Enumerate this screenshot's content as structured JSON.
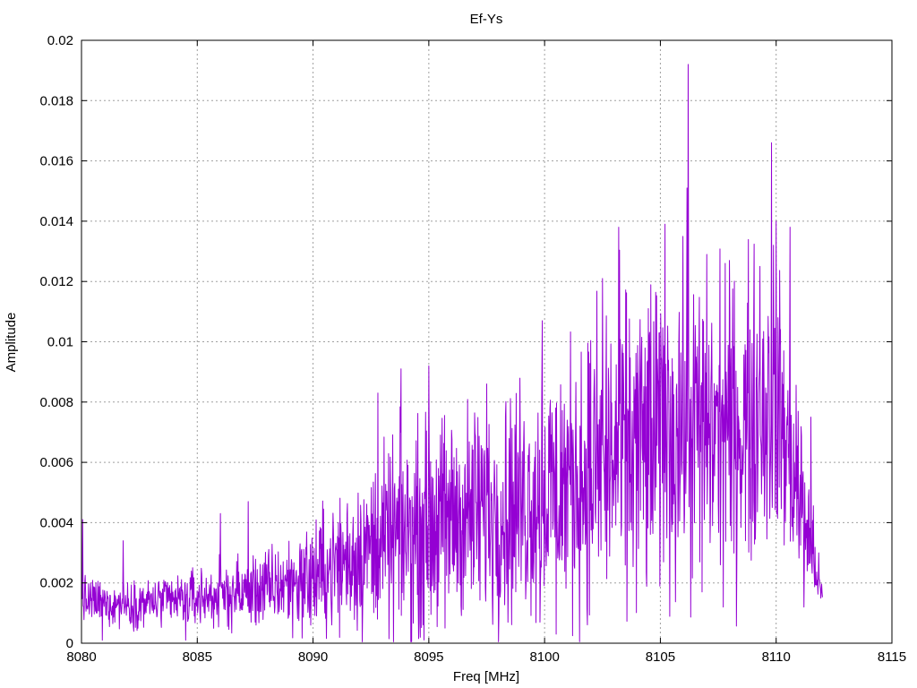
{
  "chart_data": {
    "type": "line",
    "title": "Ef-Ys",
    "xlabel": "Freq [MHz]",
    "ylabel": "Amplitude",
    "xlim": [
      8080,
      8115
    ],
    "ylim": [
      0,
      0.02
    ],
    "x_ticks": [
      8080,
      8085,
      8090,
      8095,
      8100,
      8105,
      8110,
      8115
    ],
    "x_tick_labels": [
      "8080",
      "8085",
      "8090",
      "8095",
      "8100",
      "8105",
      "8110",
      "8115"
    ],
    "y_ticks": [
      0,
      0.002,
      0.004,
      0.006,
      0.008,
      0.01,
      0.012,
      0.014,
      0.016,
      0.018,
      0.02
    ],
    "y_tick_labels": [
      "0",
      "0.002",
      "0.004",
      "0.006",
      "0.008",
      "0.01",
      "0.012",
      "0.014",
      "0.016",
      "0.018",
      "0.02"
    ],
    "grid": true,
    "series": [
      {
        "color": "#9400d3",
        "x_range": [
          8080,
          8112
        ],
        "envelope": {
          "x": [
            8080,
            8082,
            8084,
            8086,
            8088,
            8090,
            8092,
            8094,
            8096,
            8098,
            8100,
            8102,
            8104,
            8106,
            8108,
            8110,
            8111,
            8112
          ],
          "mean": [
            0.0014,
            0.0013,
            0.0014,
            0.0016,
            0.0018,
            0.0022,
            0.003,
            0.0036,
            0.0042,
            0.0044,
            0.005,
            0.0057,
            0.0065,
            0.0072,
            0.007,
            0.008,
            0.005,
            0.0015
          ],
          "amp": [
            0.0007,
            0.0007,
            0.0008,
            0.001,
            0.0012,
            0.0017,
            0.0024,
            0.003,
            0.0032,
            0.0034,
            0.0038,
            0.0045,
            0.005,
            0.0048,
            0.0046,
            0.0045,
            0.003,
            0.0003
          ]
        },
        "peaks": [
          {
            "x": 8080.05,
            "y": 0.0041
          },
          {
            "x": 8081.8,
            "y": 0.0034
          },
          {
            "x": 8086.0,
            "y": 0.0043
          },
          {
            "x": 8087.2,
            "y": 0.0047
          },
          {
            "x": 8092.8,
            "y": 0.0083
          },
          {
            "x": 8093.8,
            "y": 0.0091
          },
          {
            "x": 8095.0,
            "y": 0.0092
          },
          {
            "x": 8097.5,
            "y": 0.0086
          },
          {
            "x": 8099.9,
            "y": 0.0107
          },
          {
            "x": 8102.5,
            "y": 0.0121
          },
          {
            "x": 8103.2,
            "y": 0.0138
          },
          {
            "x": 8105.2,
            "y": 0.0139
          },
          {
            "x": 8106.2,
            "y": 0.0192
          },
          {
            "x": 8106.15,
            "y": 0.0151
          },
          {
            "x": 8107.8,
            "y": 0.0126
          },
          {
            "x": 8109.3,
            "y": 0.0125
          },
          {
            "x": 8109.8,
            "y": 0.0166
          },
          {
            "x": 8110.0,
            "y": 0.014
          },
          {
            "x": 8110.6,
            "y": 0.0138
          },
          {
            "x": 8111.5,
            "y": 0.0075
          }
        ],
        "troughs": [
          {
            "x": 8080.9,
            "y": 0.0001
          },
          {
            "x": 8084.5,
            "y": 0.0001
          },
          {
            "x": 8089.9,
            "y": 0.0006
          },
          {
            "x": 8095.7,
            "y": 0.0005
          },
          {
            "x": 8099.8,
            "y": 0.0007
          },
          {
            "x": 8100.5,
            "y": 0.0003
          },
          {
            "x": 8106.8,
            "y": 0.0017
          },
          {
            "x": 8108.3,
            "y": 0.0025
          },
          {
            "x": 8111.2,
            "y": 0.0012
          }
        ]
      }
    ]
  }
}
